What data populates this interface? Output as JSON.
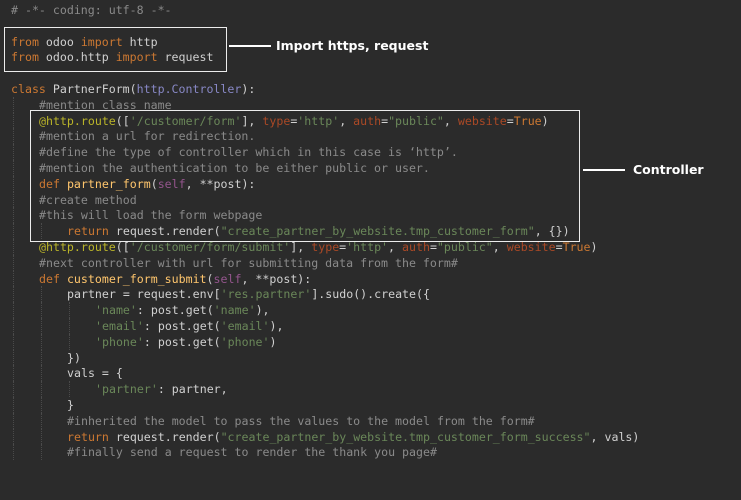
{
  "colors": {
    "background": "#2b2b2b",
    "plain": "#d0d0d0",
    "keyword": "#cc7832",
    "comment": "#8a8a8a",
    "string": "#6a8759",
    "decorator": "#bbb529",
    "builtin": "#8888c6",
    "self": "#94558d",
    "function": "#ffc66d",
    "param": "#aa4926",
    "annotation": "#ffffff"
  },
  "annotations": {
    "imports": "Import https, request",
    "controller": "Controller"
  },
  "code": [
    {
      "indent": 0,
      "tokens": [
        {
          "t": "# -*- coding: utf-8 -*-",
          "k": "comment"
        }
      ]
    },
    {
      "indent": 0,
      "tokens": []
    },
    {
      "indent": 0,
      "tokens": [
        {
          "t": "from",
          "k": "keyword"
        },
        {
          "t": " odoo ",
          "k": "plain"
        },
        {
          "t": "import",
          "k": "keyword"
        },
        {
          "t": " http",
          "k": "plain"
        }
      ]
    },
    {
      "indent": 0,
      "tokens": [
        {
          "t": "from",
          "k": "keyword"
        },
        {
          "t": " odoo.http ",
          "k": "plain"
        },
        {
          "t": "import",
          "k": "keyword"
        },
        {
          "t": " request",
          "k": "plain"
        }
      ]
    },
    {
      "indent": 0,
      "tokens": []
    },
    {
      "indent": 0,
      "tokens": [
        {
          "t": "class",
          "k": "keyword"
        },
        {
          "t": " PartnerForm(",
          "k": "plain"
        },
        {
          "t": "http.Controller",
          "k": "builtin"
        },
        {
          "t": "):",
          "k": "plain"
        }
      ]
    },
    {
      "indent": 1,
      "tokens": [
        {
          "t": "#mention class name",
          "k": "comment"
        }
      ]
    },
    {
      "indent": 1,
      "tokens": [
        {
          "t": "@http.route",
          "k": "decorator"
        },
        {
          "t": "([",
          "k": "plain"
        },
        {
          "t": "'/customer/form'",
          "k": "string"
        },
        {
          "t": "], ",
          "k": "plain"
        },
        {
          "t": "type",
          "k": "param"
        },
        {
          "t": "=",
          "k": "plain"
        },
        {
          "t": "'http'",
          "k": "string"
        },
        {
          "t": ", ",
          "k": "plain"
        },
        {
          "t": "auth",
          "k": "param"
        },
        {
          "t": "=",
          "k": "plain"
        },
        {
          "t": "\"public\"",
          "k": "string"
        },
        {
          "t": ", ",
          "k": "plain"
        },
        {
          "t": "website",
          "k": "param"
        },
        {
          "t": "=",
          "k": "plain"
        },
        {
          "t": "True",
          "k": "keyword"
        },
        {
          "t": ")",
          "k": "plain"
        }
      ]
    },
    {
      "indent": 1,
      "tokens": [
        {
          "t": "#mention a url for redirection.",
          "k": "comment"
        }
      ]
    },
    {
      "indent": 1,
      "tokens": [
        {
          "t": "#define the type of controller which in this case is ‘http’.",
          "k": "comment"
        }
      ]
    },
    {
      "indent": 1,
      "tokens": [
        {
          "t": "#mention the authentication to be either public or user.",
          "k": "comment"
        }
      ]
    },
    {
      "indent": 1,
      "tokens": [
        {
          "t": "def",
          "k": "keyword"
        },
        {
          "t": " ",
          "k": "plain"
        },
        {
          "t": "partner_form",
          "k": "function"
        },
        {
          "t": "(",
          "k": "plain"
        },
        {
          "t": "self",
          "k": "self"
        },
        {
          "t": ", **post):",
          "k": "plain"
        }
      ]
    },
    {
      "indent": 1,
      "tokens": [
        {
          "t": "#create method",
          "k": "comment"
        }
      ]
    },
    {
      "indent": 1,
      "tokens": [
        {
          "t": "#this will load the form webpage",
          "k": "comment"
        }
      ]
    },
    {
      "indent": 2,
      "tokens": [
        {
          "t": "return",
          "k": "keyword"
        },
        {
          "t": " request.render(",
          "k": "plain"
        },
        {
          "t": "\"create_partner_by_website.tmp_customer_form\"",
          "k": "string"
        },
        {
          "t": ", {})",
          "k": "plain"
        }
      ]
    },
    {
      "indent": 1,
      "tokens": [
        {
          "t": "@http.route",
          "k": "decorator"
        },
        {
          "t": "([",
          "k": "plain"
        },
        {
          "t": "'/customer/form/submit'",
          "k": "string"
        },
        {
          "t": "], ",
          "k": "plain"
        },
        {
          "t": "type",
          "k": "param"
        },
        {
          "t": "=",
          "k": "plain"
        },
        {
          "t": "'http'",
          "k": "string"
        },
        {
          "t": ", ",
          "k": "plain"
        },
        {
          "t": "auth",
          "k": "param"
        },
        {
          "t": "=",
          "k": "plain"
        },
        {
          "t": "\"public\"",
          "k": "string"
        },
        {
          "t": ", ",
          "k": "plain"
        },
        {
          "t": "website",
          "k": "param"
        },
        {
          "t": "=",
          "k": "plain"
        },
        {
          "t": "True",
          "k": "keyword"
        },
        {
          "t": ")",
          "k": "plain"
        }
      ]
    },
    {
      "indent": 1,
      "tokens": [
        {
          "t": "#next controller with url for submitting data from the form#",
          "k": "comment"
        }
      ]
    },
    {
      "indent": 1,
      "tokens": [
        {
          "t": "def",
          "k": "keyword"
        },
        {
          "t": " ",
          "k": "plain"
        },
        {
          "t": "customer_form_submit",
          "k": "function"
        },
        {
          "t": "(",
          "k": "plain"
        },
        {
          "t": "self",
          "k": "self"
        },
        {
          "t": ", **post):",
          "k": "plain"
        }
      ]
    },
    {
      "indent": 2,
      "tokens": [
        {
          "t": "partner = request.env[",
          "k": "plain"
        },
        {
          "t": "'res.partner'",
          "k": "string"
        },
        {
          "t": "].sudo().create({",
          "k": "plain"
        }
      ]
    },
    {
      "indent": 3,
      "tokens": [
        {
          "t": "'name'",
          "k": "string"
        },
        {
          "t": ": post.get(",
          "k": "plain"
        },
        {
          "t": "'name'",
          "k": "string"
        },
        {
          "t": "),",
          "k": "plain"
        }
      ]
    },
    {
      "indent": 3,
      "tokens": [
        {
          "t": "'email'",
          "k": "string"
        },
        {
          "t": ": post.get(",
          "k": "plain"
        },
        {
          "t": "'email'",
          "k": "string"
        },
        {
          "t": "),",
          "k": "plain"
        }
      ]
    },
    {
      "indent": 3,
      "tokens": [
        {
          "t": "'phone'",
          "k": "string"
        },
        {
          "t": ": post.get(",
          "k": "plain"
        },
        {
          "t": "'phone'",
          "k": "string"
        },
        {
          "t": ")",
          "k": "plain"
        }
      ]
    },
    {
      "indent": 2,
      "tokens": [
        {
          "t": "})",
          "k": "plain"
        }
      ]
    },
    {
      "indent": 2,
      "tokens": [
        {
          "t": "vals = {",
          "k": "plain"
        }
      ]
    },
    {
      "indent": 3,
      "tokens": [
        {
          "t": "'partner'",
          "k": "string"
        },
        {
          "t": ": partner,",
          "k": "plain"
        }
      ]
    },
    {
      "indent": 2,
      "tokens": [
        {
          "t": "}",
          "k": "plain"
        }
      ]
    },
    {
      "indent": 2,
      "tokens": [
        {
          "t": "#inherited the model to pass the values to the model from the form#",
          "k": "comment"
        }
      ]
    },
    {
      "indent": 2,
      "tokens": [
        {
          "t": "return",
          "k": "keyword"
        },
        {
          "t": " request.render(",
          "k": "plain"
        },
        {
          "t": "\"create_partner_by_website.tmp_customer_form_success\"",
          "k": "string"
        },
        {
          "t": ", vals)",
          "k": "plain"
        }
      ]
    },
    {
      "indent": 2,
      "tokens": [
        {
          "t": "#finally send a request to render the thank you page#",
          "k": "comment"
        }
      ]
    }
  ]
}
